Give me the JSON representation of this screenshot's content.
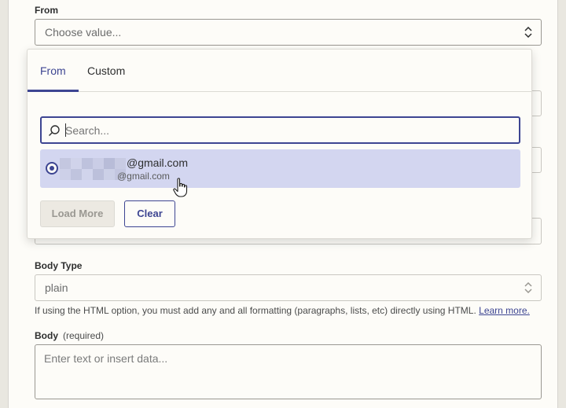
{
  "from_field": {
    "label": "From",
    "placeholder": "Choose value...",
    "dropdown": {
      "tabs": [
        {
          "label": "From",
          "active": true
        },
        {
          "label": "Custom",
          "active": false
        }
      ],
      "search_placeholder": "Search...",
      "options": [
        {
          "primary": "@gmail.com",
          "secondary": "@gmail.com",
          "selected": true
        }
      ],
      "load_more_label": "Load More",
      "clear_label": "Clear"
    }
  },
  "body_type_field": {
    "label": "Body Type",
    "value": "plain",
    "help_text": "If using the HTML option, you must add any and all formatting (paragraphs, lists, etc) directly using HTML.",
    "help_link": "Learn more."
  },
  "body_field": {
    "label": "Body",
    "required_note": "(required)",
    "placeholder": "Enter text or insert data..."
  },
  "colors": {
    "accent": "#3d4592",
    "selected_option_bg": "#d3d6f0",
    "panel_bg": "#fdfcf8"
  },
  "icons": [
    "updown-chevron-icon",
    "search-icon",
    "radio-selected-icon",
    "hand-cursor-icon"
  ]
}
